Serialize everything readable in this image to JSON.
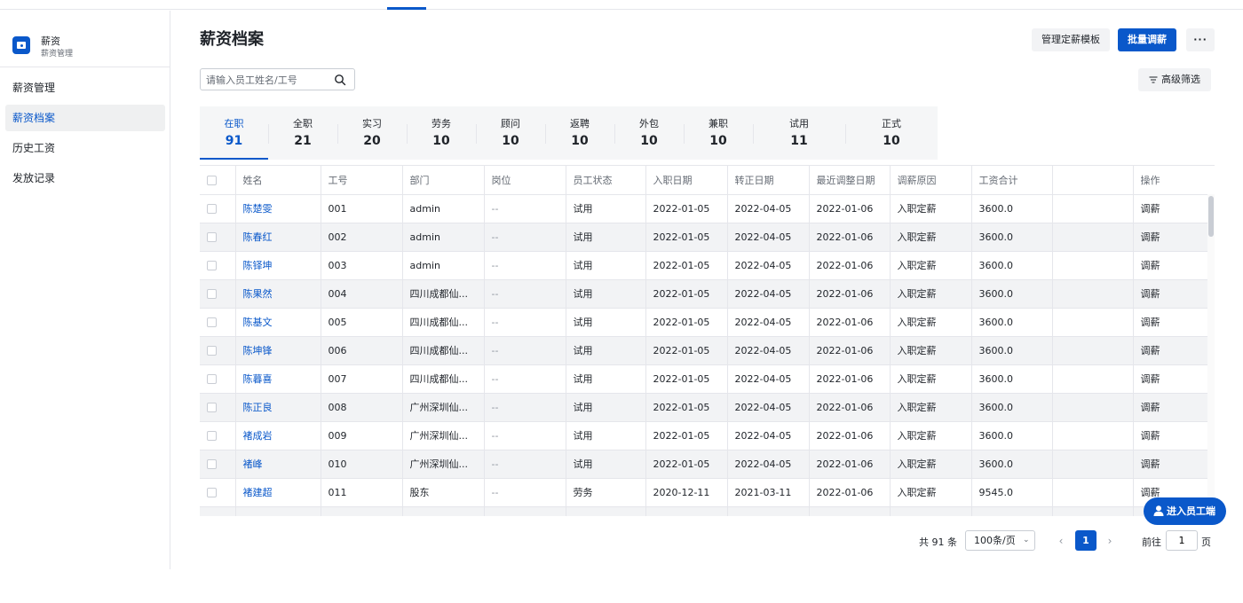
{
  "app": {
    "title": "薪资",
    "subtitle": "薪资管理"
  },
  "sidebar": {
    "items": [
      {
        "label": "薪资管理",
        "active": false
      },
      {
        "label": "薪资档案",
        "active": true
      },
      {
        "label": "历史工资",
        "active": false
      },
      {
        "label": "发放记录",
        "active": false
      }
    ]
  },
  "page": {
    "title": "薪资档案"
  },
  "toolbar": {
    "template_label": "管理定薪模板",
    "batch_label": "批量调薪",
    "more_label": "···",
    "filter_label": "高级筛选"
  },
  "search": {
    "placeholder": "请输入员工姓名/工号",
    "value": ""
  },
  "stats": [
    {
      "label": "在职",
      "value": "91",
      "active": true
    },
    {
      "label": "全职",
      "value": "21"
    },
    {
      "label": "实习",
      "value": "20"
    },
    {
      "label": "劳务",
      "value": "10"
    },
    {
      "label": "顾问",
      "value": "10"
    },
    {
      "label": "返聘",
      "value": "10"
    },
    {
      "label": "外包",
      "value": "10"
    },
    {
      "label": "兼职",
      "value": "10"
    },
    {
      "label": "试用",
      "value": "11"
    },
    {
      "label": "正式",
      "value": "10"
    }
  ],
  "table": {
    "headers": [
      "姓名",
      "工号",
      "部门",
      "岗位",
      "员工状态",
      "入职日期",
      "转正日期",
      "最近调整日期",
      "调薪原因",
      "工资合计",
      "",
      "操作"
    ],
    "rows": [
      [
        "陈楚雯",
        "001",
        "admin",
        "--",
        "试用",
        "2022-01-05",
        "2022-04-05",
        "2022-01-06",
        "入职定薪",
        "3600.0",
        "",
        "调薪"
      ],
      [
        "陈春红",
        "002",
        "admin",
        "--",
        "试用",
        "2022-01-05",
        "2022-04-05",
        "2022-01-06",
        "入职定薪",
        "3600.0",
        "",
        "调薪"
      ],
      [
        "陈铎坤",
        "003",
        "admin",
        "--",
        "试用",
        "2022-01-05",
        "2022-04-05",
        "2022-01-06",
        "入职定薪",
        "3600.0",
        "",
        "调薪"
      ],
      [
        "陈果然",
        "004",
        "四川成都仙...",
        "--",
        "试用",
        "2022-01-05",
        "2022-04-05",
        "2022-01-06",
        "入职定薪",
        "3600.0",
        "",
        "调薪"
      ],
      [
        "陈基文",
        "005",
        "四川成都仙...",
        "--",
        "试用",
        "2022-01-05",
        "2022-04-05",
        "2022-01-06",
        "入职定薪",
        "3600.0",
        "",
        "调薪"
      ],
      [
        "陈坤锋",
        "006",
        "四川成都仙...",
        "--",
        "试用",
        "2022-01-05",
        "2022-04-05",
        "2022-01-06",
        "入职定薪",
        "3600.0",
        "",
        "调薪"
      ],
      [
        "陈暮喜",
        "007",
        "四川成都仙...",
        "--",
        "试用",
        "2022-01-05",
        "2022-04-05",
        "2022-01-06",
        "入职定薪",
        "3600.0",
        "",
        "调薪"
      ],
      [
        "陈正良",
        "008",
        "广州深圳仙...",
        "--",
        "试用",
        "2022-01-05",
        "2022-04-05",
        "2022-01-06",
        "入职定薪",
        "3600.0",
        "",
        "调薪"
      ],
      [
        "褚成岩",
        "009",
        "广州深圳仙...",
        "--",
        "试用",
        "2022-01-05",
        "2022-04-05",
        "2022-01-06",
        "入职定薪",
        "3600.0",
        "",
        "调薪"
      ],
      [
        "褚峰",
        "010",
        "广州深圳仙...",
        "--",
        "试用",
        "2022-01-05",
        "2022-04-05",
        "2022-01-06",
        "入职定薪",
        "3600.0",
        "",
        "调薪"
      ],
      [
        "褚建超",
        "011",
        "股东",
        "--",
        "劳务",
        "2020-12-11",
        "2021-03-11",
        "2022-01-06",
        "入职定薪",
        "9545.0",
        "",
        "调薪"
      ],
      [
        "",
        "",
        "",
        "",
        "",
        "",
        "",
        "",
        "",
        "",
        "",
        ""
      ]
    ]
  },
  "floating": {
    "label": "进入员工端"
  },
  "pagination": {
    "total_label": "共 91 条",
    "page_size_label": "100条/页",
    "current_page": "1",
    "goto_prefix": "前往",
    "goto_value": "1",
    "goto_suffix": "页"
  },
  "colors": {
    "accent": "#0a58ca",
    "stripe": "#f2f3f5",
    "text": "#1f2329",
    "muted": "#646a73"
  }
}
